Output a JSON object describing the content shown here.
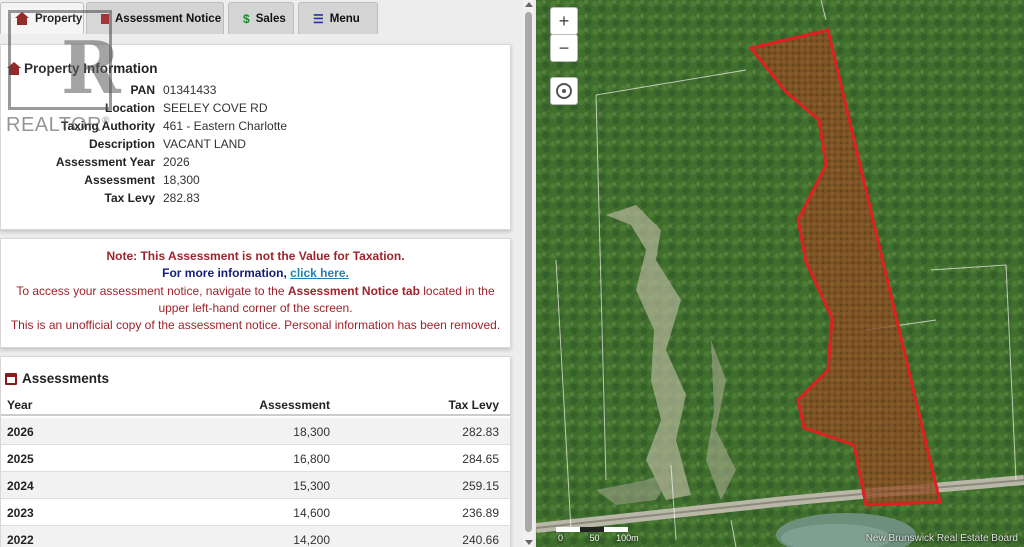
{
  "tabs": [
    {
      "label": "Property",
      "icon": "home-icon"
    },
    {
      "label": "Assessment Notice",
      "icon": "document-icon"
    },
    {
      "label": "Sales",
      "icon": "dollar-icon",
      "glyph": "$"
    },
    {
      "label": "Menu",
      "icon": "menu-icon",
      "glyph": "☰"
    }
  ],
  "property": {
    "title": "Property Information",
    "rows": [
      {
        "key": "PAN",
        "value": "01341433"
      },
      {
        "key": "Location",
        "value": "SEELEY COVE RD"
      },
      {
        "key": "Taxing Authority",
        "value": "461 - Eastern Charlotte"
      },
      {
        "key": "Description",
        "value": "VACANT LAND"
      },
      {
        "key": "Assessment Year",
        "value": "2026"
      },
      {
        "key": "Assessment",
        "value": "18,300"
      },
      {
        "key": "Tax Levy",
        "value": "282.83"
      }
    ]
  },
  "note": {
    "line1": "Note: This Assessment is not the Value for Taxation.",
    "line2_prefix": "For more information, ",
    "line2_link": "click here.",
    "line3_prefix": "To access your assessment notice, navigate to the ",
    "line3_bold": "Assessment Notice tab",
    "line3_suffix": " located in the",
    "line4": "upper left-hand corner of the screen.",
    "line5": "This is an unofficial copy of the assessment notice. Personal information has been removed."
  },
  "assessments": {
    "title": "Assessments",
    "headers": {
      "year": "Year",
      "assessment": "Assessment",
      "levy": "Tax Levy"
    },
    "rows": [
      {
        "year": "2026",
        "assessment": "18,300",
        "levy": "282.83"
      },
      {
        "year": "2025",
        "assessment": "16,800",
        "levy": "284.65"
      },
      {
        "year": "2024",
        "assessment": "15,300",
        "levy": "259.15"
      },
      {
        "year": "2023",
        "assessment": "14,600",
        "levy": "236.89"
      },
      {
        "year": "2022",
        "assessment": "14,200",
        "levy": "240.66"
      }
    ]
  },
  "watermark": {
    "word": "REALTOR",
    "mark": "®"
  },
  "map": {
    "zoom_in": "+",
    "zoom_out": "−",
    "scale_labels": [
      "0",
      "50",
      "100m"
    ],
    "attribution": "New Brunswick Real Estate Board",
    "parcel_color": "#e02020"
  }
}
